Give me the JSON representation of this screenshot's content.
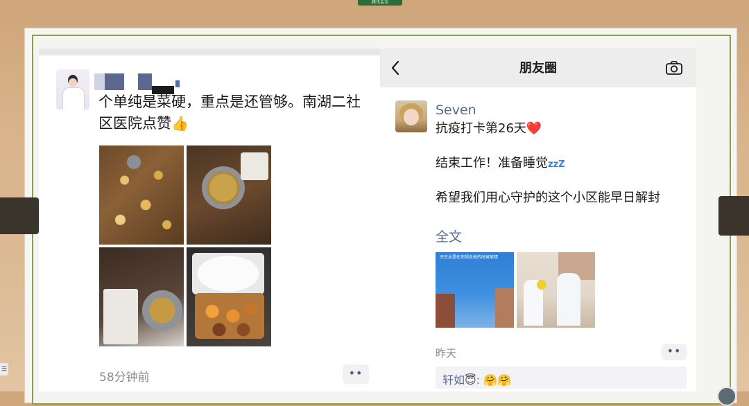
{
  "meeting_tag": "腾讯会议",
  "left_post": {
    "author_redacted": "",
    "text_line1": "个单纯是菜硬，重点是还管够。南湖二社",
    "text_line2": "区医院点赞",
    "thumb_emoji": "👍",
    "photo_count": 4,
    "time": "58分钟前",
    "more_label": "••"
  },
  "moments": {
    "nav": {
      "title": "朋友圈",
      "back_icon": "chevron-left-icon",
      "camera_icon": "camera-icon"
    },
    "post": {
      "user_name": "Seven",
      "line1": "抗疫打卡第26天",
      "line1_emoji": "❤️",
      "line2": "结束工作！准备睡觉",
      "line2_emoji": "zzZ",
      "line3": "希望我们用心守护的这个小区能早日解封",
      "full_text_link": "全文",
      "photo1_caption": "天空总是在你想念他的时候放晴",
      "time": "昨天",
      "more_label": "••",
      "comment": {
        "author": "轩如",
        "author_emoji": "😇",
        "separator": ":",
        "content": "🤗🤗"
      }
    }
  },
  "colors": {
    "link_blue": "#576b95",
    "board_border": "#8aa04e",
    "nav_bg": "#ededed"
  }
}
